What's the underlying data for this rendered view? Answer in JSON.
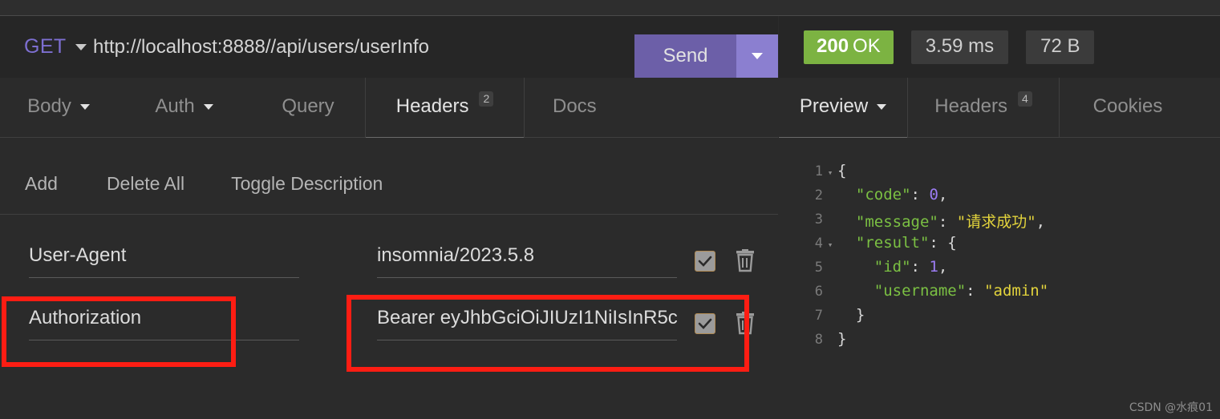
{
  "request": {
    "method": "GET",
    "url": "http://localhost:8888//api/users/userInfo",
    "send_label": "Send",
    "tabs": [
      {
        "label": "Body",
        "has_caret": true,
        "badge": "",
        "active": false
      },
      {
        "label": "Auth",
        "has_caret": true,
        "badge": "",
        "active": false
      },
      {
        "label": "Query",
        "has_caret": false,
        "badge": "",
        "active": false
      },
      {
        "label": "Headers",
        "has_caret": false,
        "badge": "2",
        "active": true
      },
      {
        "label": "Docs",
        "has_caret": false,
        "badge": "",
        "active": false
      }
    ],
    "actions": {
      "add": "Add",
      "delete_all": "Delete All",
      "toggle_description": "Toggle Description"
    },
    "headers_table": {
      "rows": [
        {
          "name": "User-Agent",
          "value": "insomnia/2023.5.8",
          "enabled": true
        },
        {
          "name": "Authorization",
          "value": "Bearer eyJhbGciOiJIUzI1NiIsInR5c",
          "enabled": true
        }
      ]
    }
  },
  "response": {
    "status": {
      "code": "200",
      "text": "OK"
    },
    "time": "3.59 ms",
    "size": "72 B",
    "tabs": [
      {
        "label": "Preview",
        "has_caret": true,
        "badge": "",
        "active": true
      },
      {
        "label": "Headers",
        "has_caret": false,
        "badge": "4",
        "active": false
      },
      {
        "label": "Cookies",
        "has_caret": false,
        "badge": "",
        "active": false
      }
    ],
    "body_lines": [
      {
        "n": "1",
        "fold": "▾",
        "indent": 0,
        "content": "{"
      },
      {
        "n": "2",
        "fold": "",
        "indent": 1,
        "content": "\"code\": 0,"
      },
      {
        "n": "3",
        "fold": "",
        "indent": 1,
        "content": "\"message\": \"请求成功\","
      },
      {
        "n": "4",
        "fold": "▾",
        "indent": 1,
        "content": "\"result\": {"
      },
      {
        "n": "5",
        "fold": "",
        "indent": 2,
        "content": "\"id\": 1,"
      },
      {
        "n": "6",
        "fold": "",
        "indent": 2,
        "content": "\"username\": \"admin\""
      },
      {
        "n": "7",
        "fold": "",
        "indent": 1,
        "content": "}"
      },
      {
        "n": "8",
        "fold": "",
        "indent": 0,
        "content": "}"
      }
    ],
    "body_json": {
      "code": 0,
      "message": "请求成功",
      "result": {
        "id": 1,
        "username": "admin"
      }
    }
  },
  "colors": {
    "accent_purple": "#6c5fa8",
    "accent_purple_light": "#8b7fd0",
    "method_purple": "#7d6fd1",
    "status_green": "#7cb342",
    "annotation_red": "#fd1d13",
    "json_key_green": "#7bc043",
    "json_string_yellow": "#e2d33c",
    "json_number_purple": "#9c7cf4"
  },
  "watermark": "CSDN @水痕01"
}
